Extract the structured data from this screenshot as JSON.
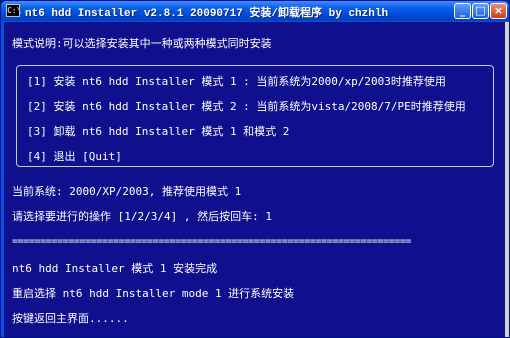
{
  "window": {
    "title": "nt6 hdd Installer v2.8.1 20090717 安装/卸载程序 by chzhlh",
    "icon_text": "C:\\",
    "minimize_icon": "minimize-icon",
    "maximize_icon": "maximize-icon",
    "close_icon": "close-icon",
    "minimize_glyph": "_",
    "maximize_glyph": "□",
    "close_glyph": "×"
  },
  "console": {
    "mode_description": "模式说明:可以选择安装其中一种或两种模式同时安装",
    "menu": [
      "[1] 安装 nt6 hdd Installer 模式 1 : 当前系统为2000/xp/2003时推荐使用",
      "[2] 安装 nt6 hdd Installer 模式 2 : 当前系统为vista/2008/7/PE时推荐使用",
      "[3] 卸载 nt6 hdd Installer 模式 1 和模式 2",
      "[4] 退出 [Quit]"
    ],
    "current_system": "当前系统: 2000/XP/2003, 推荐使用模式 1",
    "prompt": "请选择要进行的操作 [1/2/3/4] , 然后按回车: 1",
    "separator": "=======================================================================",
    "install_done": "nt6 hdd Installer 模式 1 安装完成",
    "reboot_hint": "重启选择 nt6 hdd Installer mode 1 进行系统安装",
    "press_key": "按键返回主界面......"
  },
  "colors": {
    "console_bg": "#10108e",
    "console_text": "#ffffff",
    "titlebar_blue": "#0054e3"
  }
}
